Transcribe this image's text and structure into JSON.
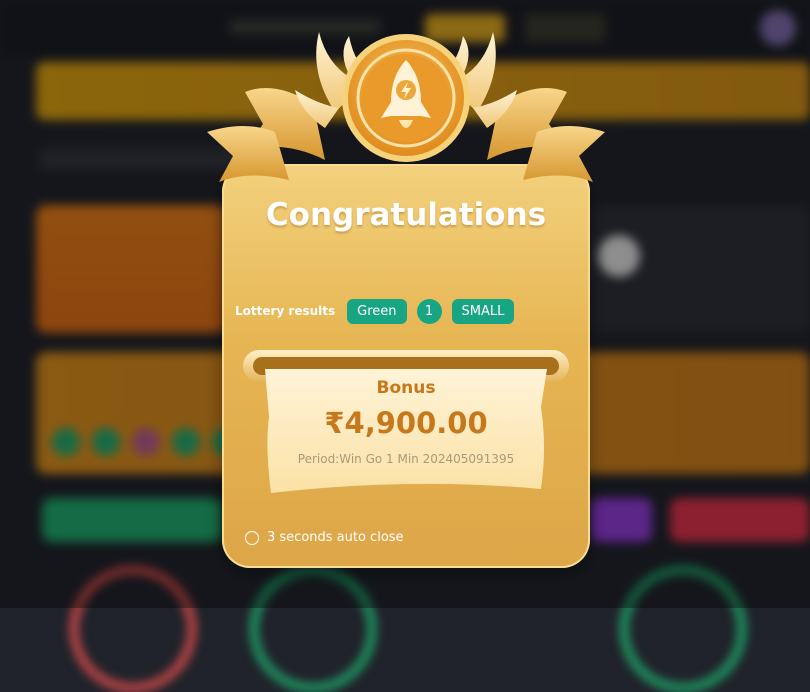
{
  "modal": {
    "title": "Congratulations",
    "badge_icon": "rocket-icon",
    "lottery_label": "Lottery results",
    "results": {
      "color": "Green",
      "number": "1",
      "size": "SMALL"
    },
    "bonus_label": "Bonus",
    "bonus_amount": "₹4,900.00",
    "period": "Period:Win Go 1 Min 202405091395",
    "auto_close": "3 seconds auto close"
  },
  "colors": {
    "gold_light": "#f3d17e",
    "gold_dark": "#dda648",
    "chip_green": "#18a584",
    "bonus_text": "#c6781a"
  }
}
